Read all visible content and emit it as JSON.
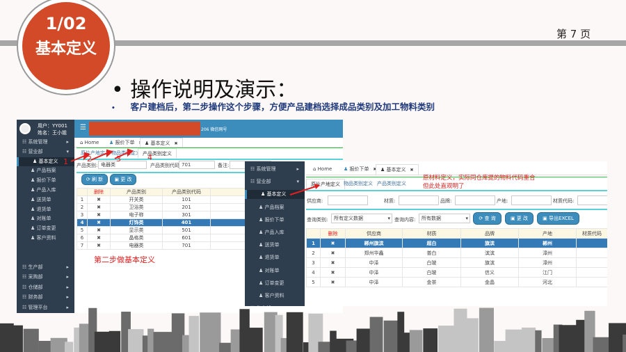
{
  "slide": {
    "section_number": "1/02",
    "section_title": "基本定义",
    "page_label": "第 7 页",
    "title": "操作说明及演示：",
    "subtitle": "客户建档后，第二步操作这个步骤，方便产品建档选择成品类别及加工物料类别",
    "bullet": "•"
  },
  "colors": {
    "accent": "#d24a27",
    "sidebar": "#2f3e4e",
    "topbar": "#3c8dbc",
    "selected_row": "#337ab7",
    "annotation": "#e02020"
  },
  "shot1": {
    "user": "用户：YY001",
    "name": "姓名：王小姐",
    "topbar_suffix": "206  微信网号",
    "sidebar": [
      {
        "label": "系统管理",
        "type": "group",
        "caret": "▸"
      },
      {
        "label": "营业部",
        "type": "group",
        "caret": "▾"
      },
      {
        "label": "基本定义",
        "type": "item",
        "active": true
      },
      {
        "label": "产品档案",
        "type": "item"
      },
      {
        "label": "报价下单",
        "type": "item"
      },
      {
        "label": "产品入库",
        "type": "item"
      },
      {
        "label": "送货单",
        "type": "item"
      },
      {
        "label": "退货单",
        "type": "item"
      },
      {
        "label": "对账单",
        "type": "item"
      },
      {
        "label": "订单变更",
        "type": "item"
      },
      {
        "label": "客户资料",
        "type": "item"
      },
      {
        "label": "生产部",
        "type": "group",
        "caret": "▸"
      },
      {
        "label": "采购部",
        "type": "group",
        "caret": "▸"
      },
      {
        "label": "仓储部",
        "type": "group",
        "caret": "▸"
      },
      {
        "label": "财务部",
        "type": "group",
        "caret": "▸"
      },
      {
        "label": "管理平台",
        "type": "group",
        "caret": "▸"
      }
    ],
    "tabs": [
      "Home",
      "报价下单",
      "基本定义"
    ],
    "subtabs": [
      "原片产地定义",
      "物品类别定义",
      "产品类别定义"
    ],
    "form": {
      "category_label": "产品类别:",
      "category_value": "电器类",
      "code_label": "产品类别代码:",
      "code_value": "701",
      "note_label": "备注:"
    },
    "buttons": {
      "refresh": "刷 新",
      "edit": "更 改"
    },
    "columns": [
      "",
      "删除",
      "产品类别",
      "产品类别代码",
      ""
    ],
    "rows": [
      [
        "1",
        "✖",
        "开关类",
        "101"
      ],
      [
        "2",
        "✖",
        "卫浴类",
        "201"
      ],
      [
        "3",
        "✖",
        "电子称",
        "301"
      ],
      [
        "4",
        "✖",
        "灯饰类",
        "401"
      ],
      [
        "5",
        "✖",
        "显示类",
        "501"
      ],
      [
        "6",
        "✖",
        "晶格类",
        "601"
      ],
      [
        "7",
        "✖",
        "电器类",
        "701"
      ]
    ],
    "selected_row": 3,
    "annotation": "第二步做基本定义",
    "step_numbers": [
      "1",
      "2",
      "3",
      "4"
    ]
  },
  "shot2": {
    "sidebar": [
      {
        "label": "系统管理",
        "type": "group",
        "caret": "▸"
      },
      {
        "label": "营业部",
        "type": "group",
        "caret": "▾"
      },
      {
        "label": "基本定义",
        "type": "item",
        "active": true
      },
      {
        "label": "产品档案",
        "type": "item"
      },
      {
        "label": "报价下单",
        "type": "item"
      },
      {
        "label": "产品入库",
        "type": "item"
      },
      {
        "label": "送货单",
        "type": "item"
      },
      {
        "label": "退货单",
        "type": "item"
      },
      {
        "label": "对账单",
        "type": "item"
      },
      {
        "label": "订单变更",
        "type": "item"
      },
      {
        "label": "客户资料",
        "type": "item"
      },
      {
        "label": "生产部",
        "type": "group",
        "caret": "▸"
      }
    ],
    "tabs": [
      "Home",
      "报价下单",
      "基本定义"
    ],
    "subtabs": [
      "原片产地定义",
      "物品类别定义",
      "产品类别定义"
    ],
    "annotation_line1": "原材料定义，实际同仓库提的物料代码重合",
    "annotation_line2": "但此处直观明了",
    "filters": {
      "supplier": "供应商:",
      "material": "材质:",
      "brand": "品牌:",
      "origin": "产地:",
      "material_code": "材质代码:"
    },
    "query": {
      "type_label": "查询类别:",
      "type_value": "所有定义数据",
      "content_label": "查询内容:",
      "content_value": "所有数据"
    },
    "buttons": {
      "query": "查 询",
      "edit": "更 改",
      "export": "导出EXCEL"
    },
    "columns": [
      "",
      "删除",
      "供应商",
      "材质",
      "品牌",
      "产地",
      "材质代码"
    ],
    "rows": [
      [
        "1",
        "✖",
        "郴州旗滨",
        "超白",
        "旗滨",
        "郴州",
        ""
      ],
      [
        "2",
        "✖",
        "郑州华鑫",
        "普白",
        "滨滨",
        "漳州",
        ""
      ],
      [
        "3",
        "✖",
        "中泽",
        "白玻",
        "旗滨",
        "漳州",
        ""
      ],
      [
        "4",
        "✖",
        "中泽",
        "白玻",
        "信义",
        "江门",
        ""
      ],
      [
        "5",
        "✖",
        "中泽",
        "金茶",
        "金晶",
        "河北",
        ""
      ]
    ],
    "selected_row": 0
  }
}
